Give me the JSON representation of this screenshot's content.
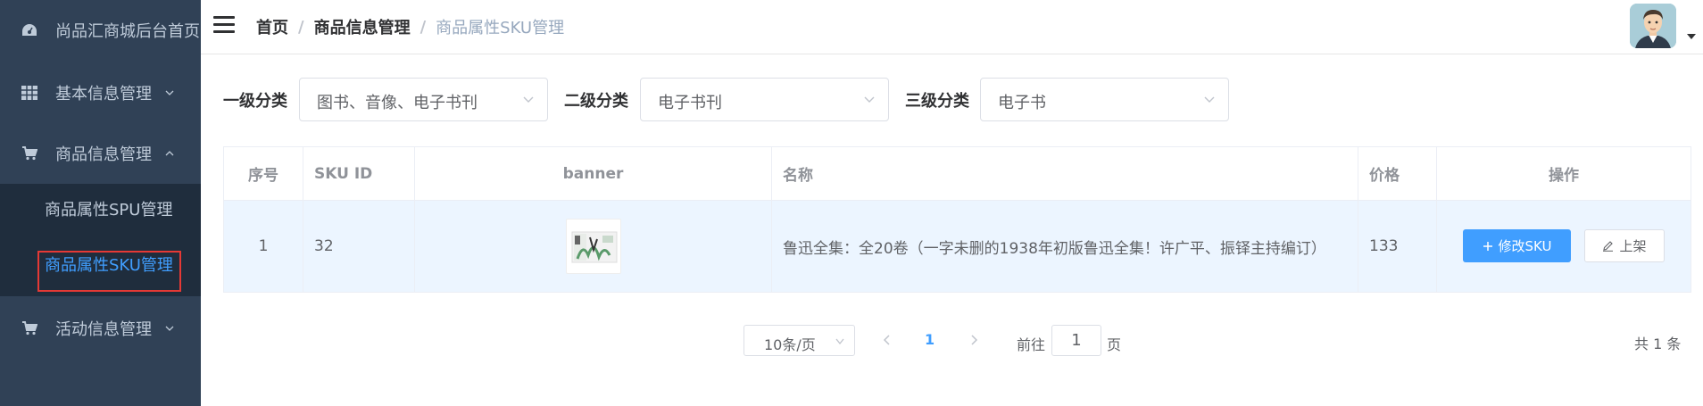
{
  "sidebar": {
    "home_label": "尚品汇商城后台首页",
    "items": [
      {
        "label": "基本信息管理",
        "icon": "table-icon"
      },
      {
        "label": "商品信息管理",
        "icon": "cart-icon"
      },
      {
        "label": "活动信息管理",
        "icon": "cart-icon"
      }
    ],
    "sub_items": [
      {
        "label": "商品属性SPU管理"
      },
      {
        "label": "商品属性SKU管理",
        "active": true
      }
    ],
    "colors": {
      "bg": "#304156",
      "sub_bg": "#1f2d3d",
      "text": "#bfcbd9",
      "active": "#409eff",
      "highlight_box": "#e53935"
    }
  },
  "navbar": {
    "breadcrumb": [
      "首页",
      "商品信息管理",
      "商品属性SKU管理"
    ],
    "separator": "/"
  },
  "filters": {
    "level1": {
      "label": "一级分类",
      "value": "图书、音像、电子书刊"
    },
    "level2": {
      "label": "二级分类",
      "value": "电子书刊"
    },
    "level3": {
      "label": "三级分类",
      "value": "电子书"
    }
  },
  "table": {
    "headers": [
      "序号",
      "SKU ID",
      "banner",
      "名称",
      "价格",
      "操作"
    ],
    "rows": [
      {
        "index": "1",
        "sku_id": "32",
        "name": "鲁迅全集：全20卷（一字未删的1938年初版鲁迅全集！许广平、振铎主持编订）",
        "price": "133"
      }
    ],
    "edit_button": "修改SKU",
    "list_button": "上架"
  },
  "pagination": {
    "page_size": "10条/页",
    "current_page": "1",
    "goto_prefix": "前往",
    "goto_value": "1",
    "goto_suffix": "页",
    "total": "共 1 条"
  }
}
